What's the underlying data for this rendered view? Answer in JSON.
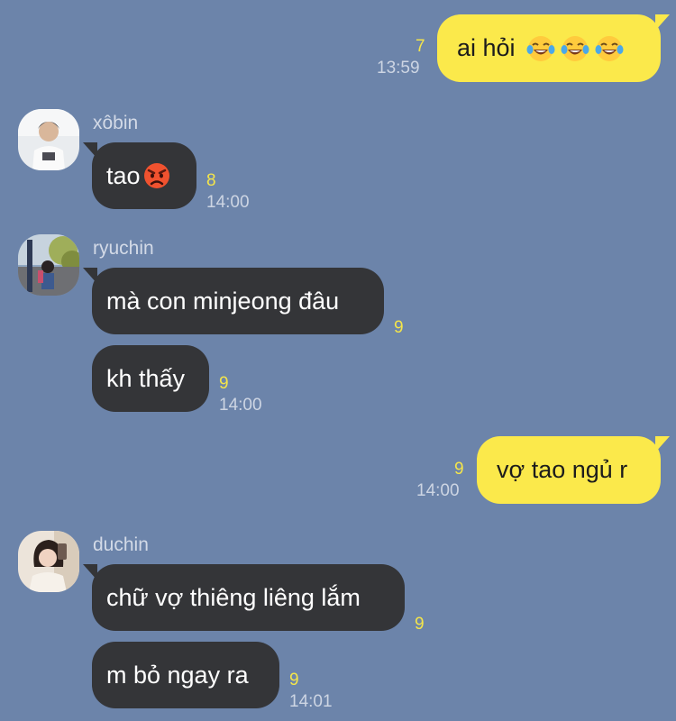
{
  "colors": {
    "background": "#6c84aa",
    "outgoing_bubble": "#fbe94b",
    "incoming_bubble": "#343538",
    "unread_count": "#f4e54a"
  },
  "messages": [
    {
      "sender": "me",
      "text": "ai hỏi",
      "emojis": [
        "tears-of-joy-emoji",
        "tears-of-joy-emoji",
        "tears-of-joy-emoji"
      ],
      "count": "7",
      "time": "13:59"
    },
    {
      "sender": "xôbin",
      "text": "tao",
      "emojis": [
        "angry-face-emoji"
      ],
      "count": "8",
      "time": "14:00"
    },
    {
      "sender": "ryuchin",
      "text": "mà con minjeong đâu",
      "count": "9"
    },
    {
      "sender": "ryuchin",
      "text": "kh thấy",
      "count": "9",
      "time": "14:00"
    },
    {
      "sender": "me",
      "text": "vợ tao ngủ r",
      "count": "9",
      "time": "14:00"
    },
    {
      "sender": "duchin",
      "text": "chữ vợ thiêng liêng lắm",
      "count": "9"
    },
    {
      "sender": "duchin",
      "text": "m bỏ ngay ra",
      "count": "9",
      "time": "14:01"
    }
  ]
}
